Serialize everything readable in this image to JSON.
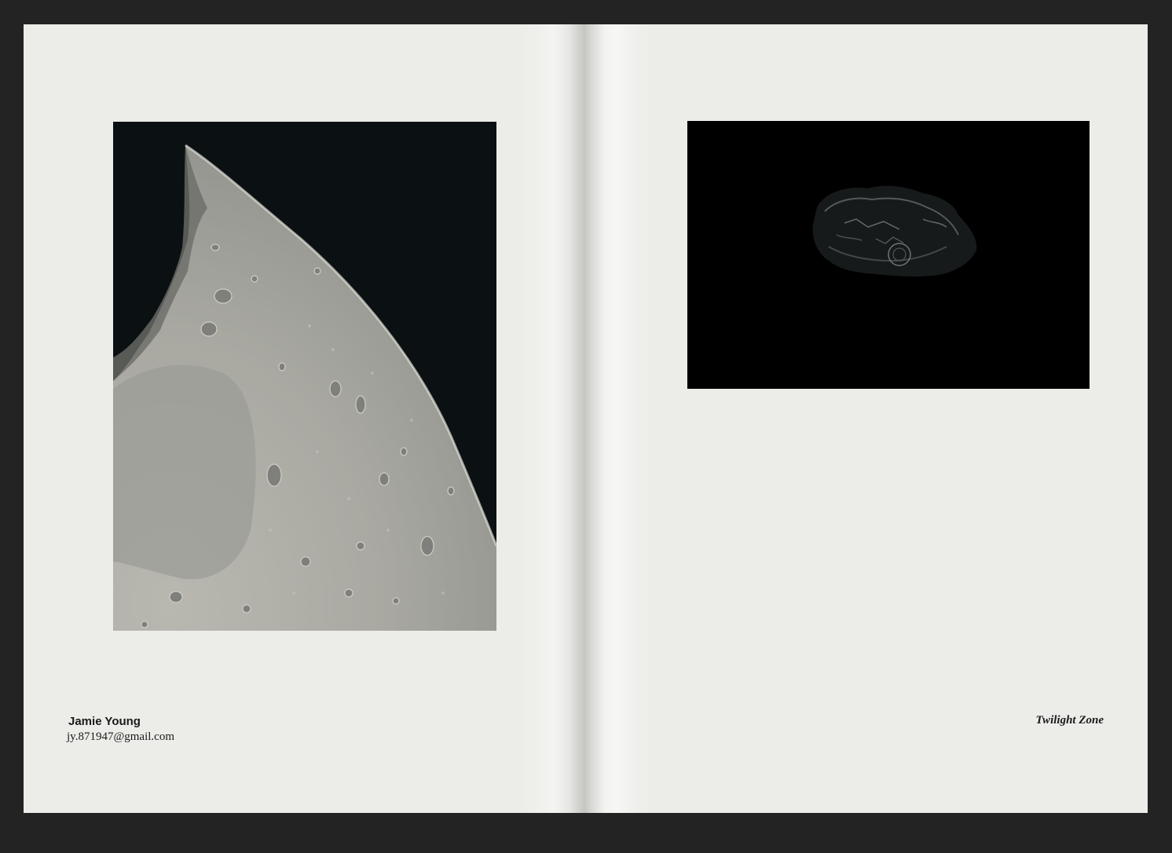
{
  "left_page": {
    "author_name": "Jamie Young",
    "author_email": "jy.871947@gmail.com"
  },
  "right_page": {
    "title": "Twilight Zone"
  },
  "colors": {
    "viewer_background": "#232323",
    "page_background": "#ecece9",
    "text": "#1a1a1a"
  }
}
